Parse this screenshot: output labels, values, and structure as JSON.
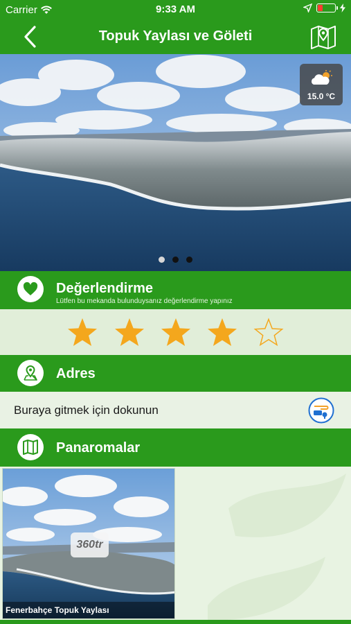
{
  "status": {
    "carrier": "Carrier",
    "time": "9:33 AM"
  },
  "nav": {
    "title": "Topuk Yaylası ve Göleti",
    "back_icon": "chevron-left-icon",
    "map_icon": "map-pin-icon"
  },
  "hero": {
    "temperature": "15.0 °C",
    "weather_icon": "partly-cloudy-icon",
    "page_count": 3,
    "active_page": 1
  },
  "rating": {
    "title": "Değerlendirme",
    "subtitle": "Lütfen bu mekanda bulunduysanız değerlendirme yapınız",
    "stars_filled": 4,
    "stars_total": 5
  },
  "address": {
    "title": "Adres",
    "action_text": "Buraya gitmek için dokunun"
  },
  "panoramas": {
    "title": "Panaromalar",
    "items": [
      {
        "caption": "Fenerbahçe Topuk Yaylası",
        "badge": "360tr"
      }
    ]
  },
  "colors": {
    "brand_green": "#2a9a1c",
    "star": "#f4a71d"
  }
}
